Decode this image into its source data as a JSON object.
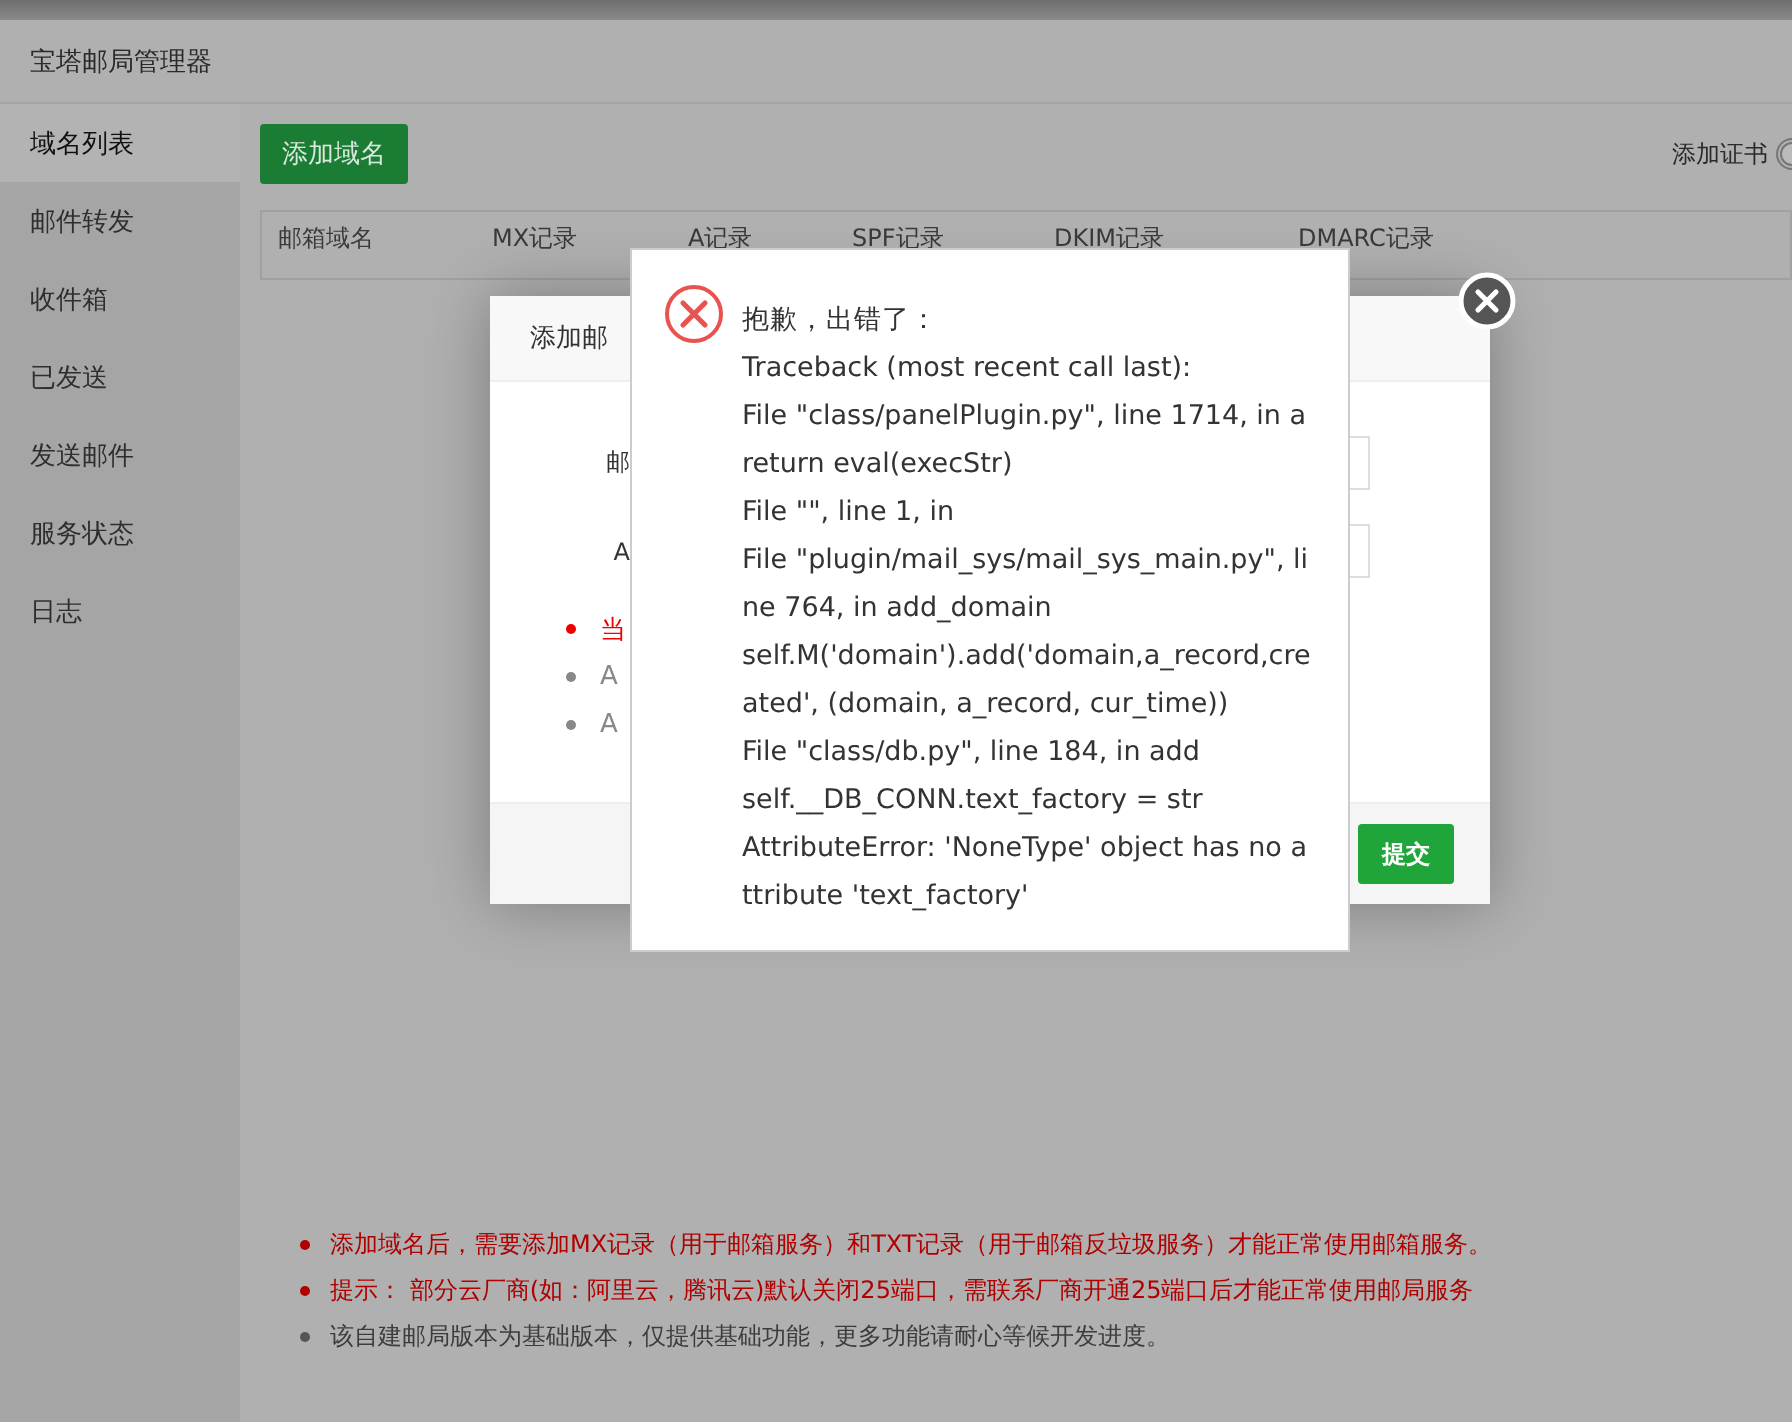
{
  "window": {
    "title": "宝塔邮局管理器"
  },
  "sidebar": {
    "items": [
      {
        "label": "域名列表",
        "selected": true
      },
      {
        "label": "邮件转发",
        "selected": false
      },
      {
        "label": "收件箱",
        "selected": false
      },
      {
        "label": "已发送",
        "selected": false
      },
      {
        "label": "发送邮件",
        "selected": false
      },
      {
        "label": "服务状态",
        "selected": false
      },
      {
        "label": "日志",
        "selected": false
      }
    ]
  },
  "toolbar": {
    "add_button": "添加域名",
    "cert_label": "添加证书",
    "cert_toggle": {
      "on": false
    }
  },
  "table": {
    "columns": [
      "邮箱域名",
      "MX记录",
      "A记录",
      "SPF记录",
      "DKIM记录",
      "DMARC记录"
    ]
  },
  "notes": [
    {
      "kind": "warning",
      "text": "添加域名后，需要添加MX记录（用于邮箱服务）和TXT记录（用于邮箱反垃圾服务）才能正常使用邮箱服务。"
    },
    {
      "kind": "warning",
      "text": "提示： 部分云厂商(如：阿里云，腾讯云)默认关闭25端口，需联系厂商开通25端口后才能正常使用邮局服务"
    },
    {
      "kind": "info",
      "text": "该自建邮局版本为基础版本，仅提供基础功能，更多功能请耐心等候开发进度。"
    }
  ],
  "form_dialog": {
    "title": "添加邮",
    "fields": [
      {
        "label": "邮"
      },
      {
        "label": "A"
      }
    ],
    "notes": [
      {
        "kind": "warning",
        "text": "当"
      },
      {
        "kind": "info",
        "text": "A"
      },
      {
        "kind": "info",
        "text": "A"
      }
    ],
    "submit_button": "提交"
  },
  "error_dialog": {
    "lines": [
      "抱歉，出错了：",
      "Traceback (most recent call last):",
      "File \"class/panelPlugin.py\", line 1714, in a",
      "return eval(execStr)",
      "File \"\", line 1, in",
      "File \"plugin/mail_sys/mail_sys_main.py\", li",
      "ne 764, in add_domain",
      "self.M('domain').add('domain,a_record,cre",
      "ated', (domain, a_record, cur_time))",
      "File \"class/db.py\", line 184, in add",
      "self.__DB_CONN.text_factory = str",
      "AttributeError: 'NoneType' object has no a",
      "ttribute 'text_factory'"
    ]
  }
}
